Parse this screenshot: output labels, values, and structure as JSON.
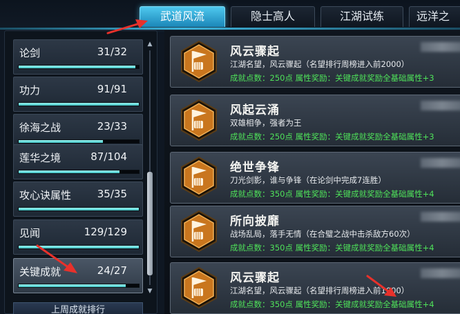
{
  "tabs": [
    {
      "label": "武道风流",
      "active": true
    },
    {
      "label": "隐士高人",
      "active": false
    },
    {
      "label": "江湖试练",
      "active": false
    },
    {
      "label": "远洋之",
      "active": false
    }
  ],
  "sidebar": {
    "items": [
      {
        "name": "论剑",
        "count": "31/32",
        "progress": 0.97,
        "selected": false
      },
      {
        "name": "功力",
        "count": "91/91",
        "progress": 1.0,
        "selected": false
      },
      {
        "name": "徐海之战",
        "count": "23/33",
        "progress": 0.7,
        "selected": false
      },
      {
        "name": "莲华之境",
        "count": "87/104",
        "progress": 0.84,
        "selected": false
      },
      {
        "name": "攻心诀属性",
        "count": "35/35",
        "progress": 1.0,
        "selected": false
      },
      {
        "name": "见闻",
        "count": "129/129",
        "progress": 1.0,
        "selected": false
      },
      {
        "name": "关键成就",
        "count": "24/27",
        "progress": 0.89,
        "selected": true
      }
    ],
    "rank_button": "上周成就排行"
  },
  "achievements": [
    {
      "title": "风云骤起",
      "desc": "江湖名望，风云骤起（名望排行周榜进入前2000）",
      "reward": "成就点数：250点 属性奖励：关键成就奖励全基础属性+3"
    },
    {
      "title": "风起云涌",
      "desc": "双雄相争，强者为王",
      "reward": "成就点数：250点 属性奖励：关键成就奖励全基础属性+3"
    },
    {
      "title": "绝世争锋",
      "desc": "刀光剑影，谁与争锋（在论剑中完成7连胜）",
      "reward": "成就点数：350点 属性奖励：关键成就奖励全基础属性+4"
    },
    {
      "title": "所向披靡",
      "desc": "战场乱局，落手无情（在合璧之战中击杀敌方60次）",
      "reward": "成就点数：350点 属性奖励：关键成就奖励全基础属性+4"
    },
    {
      "title": "风云骤起",
      "desc": "江湖名望，风云骤起（名望排行周榜进入前1000）",
      "reward": "成就点数：350点 属性奖励：关键成就奖励全基础属性+4"
    }
  ],
  "colors": {
    "accent": "#3fb6de",
    "reward_green": "#4fe25a",
    "badge_orange": "#c9761e",
    "annotation_red": "#e8312b"
  }
}
